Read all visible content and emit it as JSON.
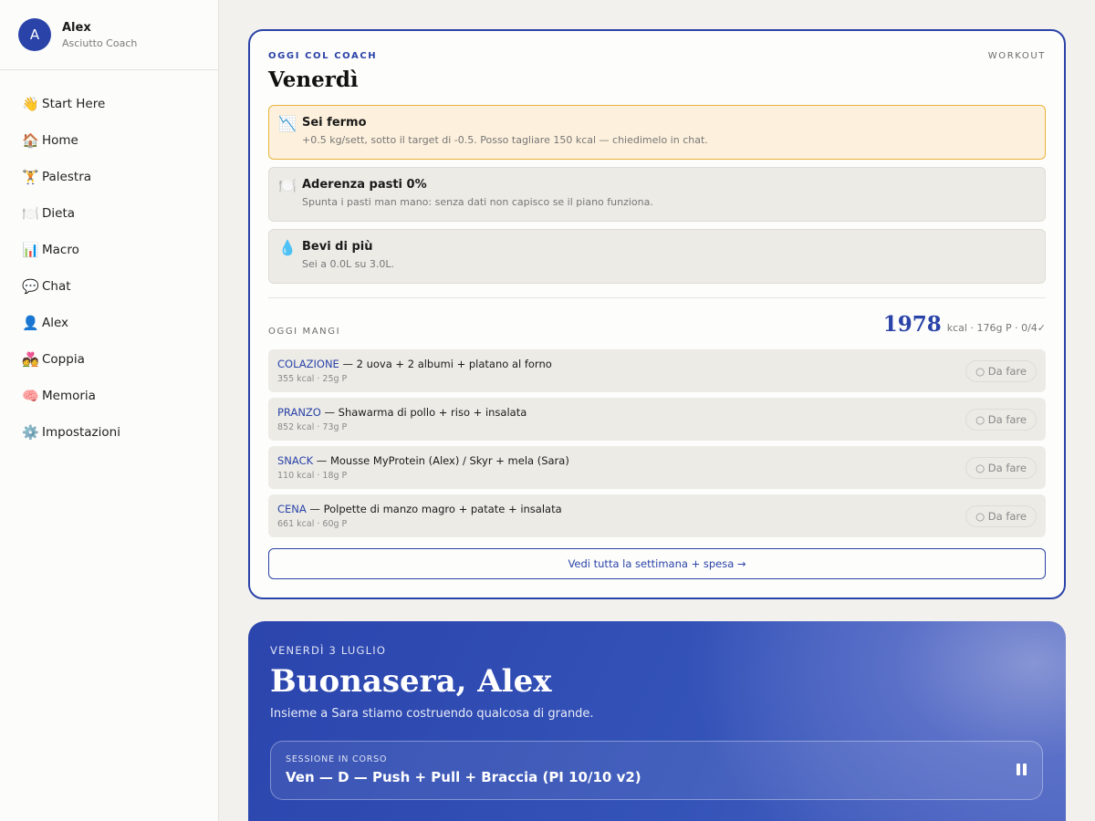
{
  "profile": {
    "avatar_initial": "A",
    "name": "Alex",
    "subtitle": "Asciutto Coach"
  },
  "nav": [
    {
      "icon": "👋",
      "icon_name": "waving-hand-icon",
      "label": "Start Here"
    },
    {
      "icon": "🏠",
      "icon_name": "house-icon",
      "label": "Home"
    },
    {
      "icon": "🏋️",
      "icon_name": "weightlifter-icon",
      "label": "Palestra"
    },
    {
      "icon": "🍽️",
      "icon_name": "plate-icon",
      "label": "Dieta"
    },
    {
      "icon": "📊",
      "icon_name": "bar-chart-icon",
      "label": "Macro"
    },
    {
      "icon": "💬",
      "icon_name": "speech-bubble-icon",
      "label": "Chat"
    },
    {
      "icon": "👤",
      "icon_name": "person-icon",
      "label": "Alex"
    },
    {
      "icon": "💑",
      "icon_name": "couple-icon",
      "label": "Coppia"
    },
    {
      "icon": "🧠",
      "icon_name": "brain-icon",
      "label": "Memoria"
    },
    {
      "icon": "⚙️",
      "icon_name": "gear-icon",
      "label": "Impostazioni"
    }
  ],
  "coach": {
    "kicker": "OGGI COL COACH",
    "workout_link": "WORKOUT",
    "day": "Venerdì",
    "alerts": [
      {
        "icon": "📉",
        "icon_name": "chart-decreasing-icon",
        "title": "Sei fermo",
        "text": "+0.5 kg/sett, sotto il target di -0.5. Posso tagliare 150 kcal — chiedimelo in chat.",
        "variant": "warn"
      },
      {
        "icon": "🍽️",
        "icon_name": "plate-icon",
        "title": "Aderenza pasti 0%",
        "text": "Spunta i pasti man mano: senza dati non capisco se il piano funziona.",
        "variant": "neutral"
      },
      {
        "icon": "💧",
        "icon_name": "droplet-icon",
        "title": "Bevi di più",
        "text": "Sei a 0.0L su 3.0L.",
        "variant": "neutral"
      }
    ],
    "meals_label": "OGGI MANGI",
    "total_kcal": "1978",
    "total_meta": "kcal · 176g P · 0/4✓",
    "meals": [
      {
        "type": "COLAZIONE",
        "desc": " — 2 uova + 2 albumi + platano al forno",
        "sub": "355 kcal · 25g P",
        "status": "○  Da fare"
      },
      {
        "type": "PRANZO",
        "desc": " — Shawarma di pollo + riso + insalata",
        "sub": "852 kcal · 73g P",
        "status": "○  Da fare"
      },
      {
        "type": "SNACK",
        "desc": " — Mousse MyProtein (Alex) / Skyr + mela (Sara)",
        "sub": "110 kcal · 18g P",
        "status": "○  Da fare"
      },
      {
        "type": "CENA",
        "desc": " — Polpette di manzo magro + patate + insalata",
        "sub": "661 kcal · 60g P",
        "status": "○  Da fare"
      }
    ],
    "week_button": "Vedi tutta la settimana + spesa →"
  },
  "hero": {
    "date": "VENERDÌ 3 LUGLIO",
    "greeting": "Buonasera, Alex",
    "subtitle": "Insieme a Sara stiamo costruendo qualcosa di grande.",
    "session_label": "SESSIONE IN CORSO",
    "session_title": "Ven — D — Push + Pull + Braccia (PI 10/10 v2)"
  },
  "colors": {
    "accent": "#2a43a8",
    "warn_border": "#e8b43a",
    "warn_bg": "#fdf0dc",
    "card_bg": "#fdfdfb",
    "page_bg": "#f2f1ee"
  }
}
